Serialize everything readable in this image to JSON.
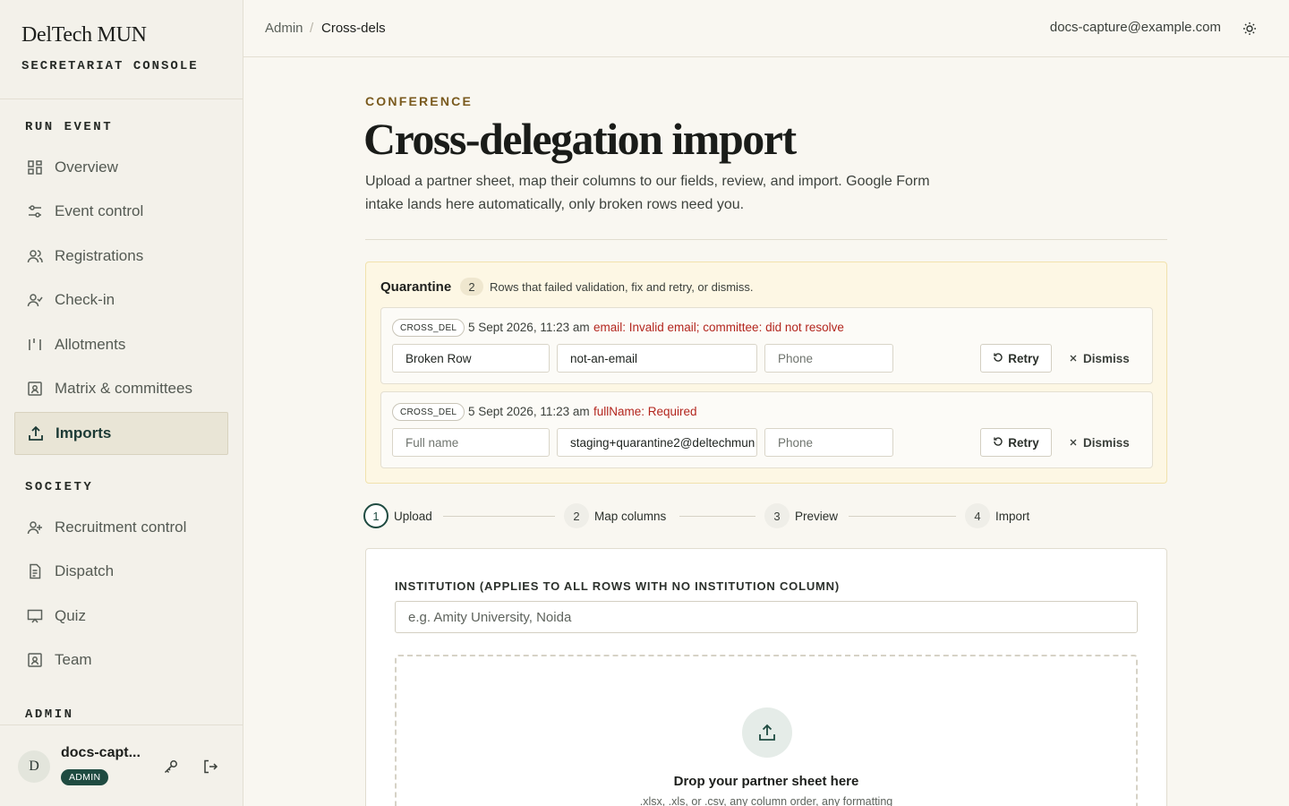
{
  "brand": {
    "title": "DelTech MUN",
    "subtitle": "SECRETARIAT CONSOLE"
  },
  "sidebar": {
    "sections": [
      {
        "label": "RUN EVENT"
      },
      {
        "label": "SOCIETY"
      },
      {
        "label": "ADMIN"
      }
    ],
    "items": [
      {
        "label": "Overview",
        "icon": "grid-icon"
      },
      {
        "label": "Event control",
        "icon": "sliders-icon"
      },
      {
        "label": "Registrations",
        "icon": "users-icon"
      },
      {
        "label": "Check-in",
        "icon": "user-check-icon"
      },
      {
        "label": "Allotments",
        "icon": "columns-icon"
      },
      {
        "label": "Matrix & committees",
        "icon": "id-card-icon"
      },
      {
        "label": "Imports",
        "icon": "upload-icon",
        "active": true
      },
      {
        "label": "Recruitment control",
        "icon": "user-plus-icon"
      },
      {
        "label": "Dispatch",
        "icon": "file-icon"
      },
      {
        "label": "Quiz",
        "icon": "presentation-icon"
      },
      {
        "label": "Team",
        "icon": "id-card-icon"
      }
    ]
  },
  "user": {
    "initial": "D",
    "name": "docs-capt...",
    "role": "ADMIN"
  },
  "topbar": {
    "breadcrumb": [
      "Admin",
      "Cross-dels"
    ],
    "separator": "/",
    "email": "docs-capture@example.com"
  },
  "page": {
    "eyebrow": "CONFERENCE",
    "title": "Cross-delegation import",
    "description": "Upload a partner sheet, map their columns to our fields, review, and import. Google Form intake lands here automatically, only broken rows need you."
  },
  "quarantine": {
    "title": "Quarantine",
    "count": "2",
    "description": "Rows that failed validation, fix and retry, or dismiss.",
    "rows": [
      {
        "tag": "CROSS_DEL",
        "time": "5 Sept 2026, 11:23 am",
        "error": "email: Invalid email; committee: did not resolve",
        "name_value": "Broken Row",
        "email_value": "not-an-email",
        "phone_placeholder": "Phone"
      },
      {
        "tag": "CROSS_DEL",
        "time": "5 Sept 2026, 11:23 am",
        "error": "fullName: Required",
        "name_placeholder": "Full name",
        "email_value": "staging+quarantine2@deltechmun",
        "phone_placeholder": "Phone"
      }
    ],
    "retry_label": "Retry",
    "dismiss_label": "Dismiss"
  },
  "steps": [
    {
      "num": "1",
      "label": "Upload",
      "active": true
    },
    {
      "num": "2",
      "label": "Map columns"
    },
    {
      "num": "3",
      "label": "Preview"
    },
    {
      "num": "4",
      "label": "Import"
    }
  ],
  "upload": {
    "institution_label": "INSTITUTION (APPLIES TO ALL ROWS WITH NO INSTITUTION COLUMN)",
    "institution_placeholder": "e.g. Amity University, Noida",
    "drop_title": "Drop your partner sheet here",
    "drop_subtitle": ".xlsx, .xls, or .csv, any column order, any formatting"
  },
  "colors": {
    "accent": "#1f4b41",
    "eyebrow": "#7a5a1e",
    "error": "#b3261e",
    "quarantine_bg": "#fdf7e4"
  }
}
